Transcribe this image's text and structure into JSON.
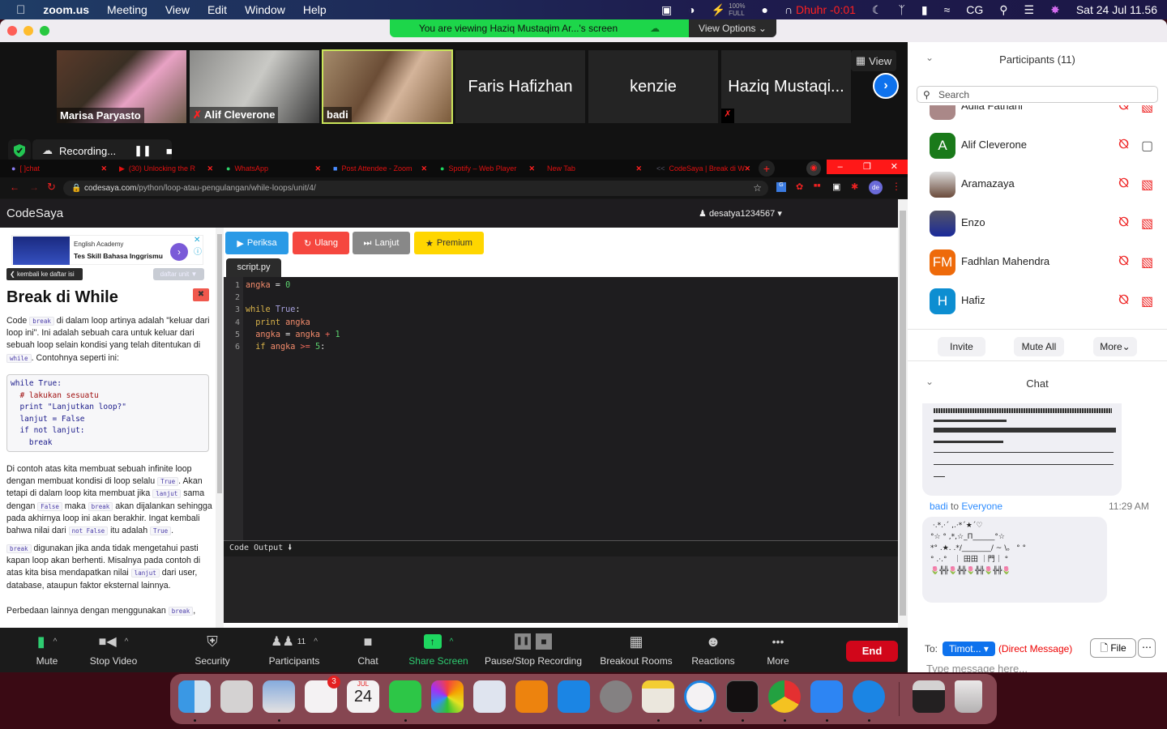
{
  "menubar": {
    "app": "zoom.us",
    "items": [
      "Meeting",
      "View",
      "Edit",
      "Window",
      "Help"
    ],
    "battery_pct": "100%",
    "battery_label": "FULL",
    "prayer": "Dhuhr -0:01",
    "user_initials": "CG",
    "datetime": "Sat 24 Jul  11.56"
  },
  "zoom": {
    "banner": "You are viewing Haziq Mustaqim Ar...'s screen",
    "view_options": "View Options",
    "view_label": "View",
    "tiles": [
      {
        "name": "Marisa Paryasto",
        "video": true
      },
      {
        "name": "Alif Cleverone",
        "video": true,
        "muted": true
      },
      {
        "name": "badi",
        "video": true,
        "active": true
      },
      {
        "name": "Faris Hafizhan"
      },
      {
        "name": "kenzie"
      },
      {
        "name": "Haziq Mustaqi...",
        "muted": true
      }
    ],
    "recording": "Recording...",
    "toolbar": {
      "mute": "Mute",
      "stop_video": "Stop Video",
      "security": "Security",
      "participants": "Participants",
      "participants_count": "11",
      "chat": "Chat",
      "share": "Share Screen",
      "record": "Pause/Stop Recording",
      "breakout": "Breakout Rooms",
      "reactions": "Reactions",
      "more": "More",
      "end": "End"
    }
  },
  "browser": {
    "tabs": [
      {
        "title": "[ ]chat"
      },
      {
        "title": "(30) Unlocking the R"
      },
      {
        "title": "WhatsApp"
      },
      {
        "title": "Post Attendee - Zoom"
      },
      {
        "title": "Spotify – Web Player"
      },
      {
        "title": "New Tab"
      },
      {
        "title": "CodeSaya | Break di W"
      }
    ],
    "url_host": "codesaya.com",
    "url_path": "/python/loop-atau-pengulangan/while-loops/unit/4/",
    "profile": "de"
  },
  "codesaya": {
    "brand": "CodeSaya",
    "user": "desatya1234567",
    "ad": {
      "sponsor": "English Academy",
      "headline": "Tes Skill Bahasa Inggrismu"
    },
    "back": "kembali ke daftar isi",
    "units": "daftar unit",
    "title": "Break di While",
    "p1": [
      "Code ",
      "break",
      " di dalam loop artinya adalah \"keluar dari loop ini\". Ini adalah sebuah cara untuk keluar dari sebuah loop selain kondisi yang telah ditentukan di ",
      "while",
      ". Contohnya seperti ini:"
    ],
    "example": [
      "while True:",
      "  # lakukan sesuatu",
      "  print \"Lanjutkan loop?\"",
      "  lanjut = False",
      "  if not lanjut:",
      "    break"
    ],
    "p2": [
      "Di contoh atas kita membuat sebuah infinite loop dengan membuat kondisi di loop selalu ",
      "True",
      ". Akan tetapi di dalam loop kita membuat jika ",
      "lanjut",
      " sama dengan ",
      "False",
      " maka ",
      "break",
      " akan dijalankan sehingga pada akhirnya loop ini akan berakhir. Ingat kembali bahwa nilai dari ",
      "not False",
      " itu adalah ",
      "True",
      "."
    ],
    "p3": [
      "break",
      " digunakan jika anda tidak mengetahui pasti kapan loop akan berhenti. Misalnya pada contoh di atas kita bisa mendapatkan nilai ",
      "lanjut",
      " dari user, database, ataupun faktor eksternal lainnya."
    ],
    "p4": [
      "Perbedaan lainnya dengan menggunakan ",
      "break",
      ","
    ],
    "buttons": {
      "check": "Periksa",
      "reset": "Ulang",
      "next": "Lanjut",
      "premium": "Premium"
    },
    "file": "script.py",
    "code_lines": [
      "angka = 0",
      "",
      "while True:",
      "  print angka",
      "  angka = angka + 1",
      "  if angka >= 5:"
    ],
    "output_label": "Code Output"
  },
  "panel": {
    "participants_title": "Participants (11)",
    "search_placeholder": "Search",
    "participants": [
      {
        "name": "Adila Fathani",
        "initials": "",
        "partial": true
      },
      {
        "name": "Alif Cleverone",
        "initials": "A",
        "color": "#1a7a1a",
        "video_on": true
      },
      {
        "name": "Aramazaya",
        "initials": "",
        "photo": true
      },
      {
        "name": "Enzo",
        "initials": "",
        "photo": true
      },
      {
        "name": "Fadhlan Mahendra",
        "initials": "FM",
        "color": "#ee6a0a"
      },
      {
        "name": "Hafiz",
        "initials": "H",
        "color": "#0d8ed1"
      }
    ],
    "invite": "Invite",
    "mute_all": "Mute All",
    "more": "More",
    "chat_title": "Chat",
    "message": {
      "sender": "badi",
      "to_word": "to",
      "recipient": "Everyone",
      "time": "11:29 AM",
      "art": " ·.*.·´ ,.·*´★´♡\n°☆ ° ,*,☆_Π______°☆\n*° .★. .*/________/ ~ \\。 ° °\n° .·.°   ｜ 田田 ｜門｜ °\n🌷╬╬🌷╬╬🌷╬╬🌷╬╬🌷"
    },
    "to_label": "To:",
    "to_value": "Timot...",
    "direct": "(Direct Message)",
    "file": "File",
    "input_placeholder": "Type message here..."
  },
  "dock": {
    "reminders_badge": "3",
    "calendar_month": "JUL",
    "calendar_day": "24"
  }
}
